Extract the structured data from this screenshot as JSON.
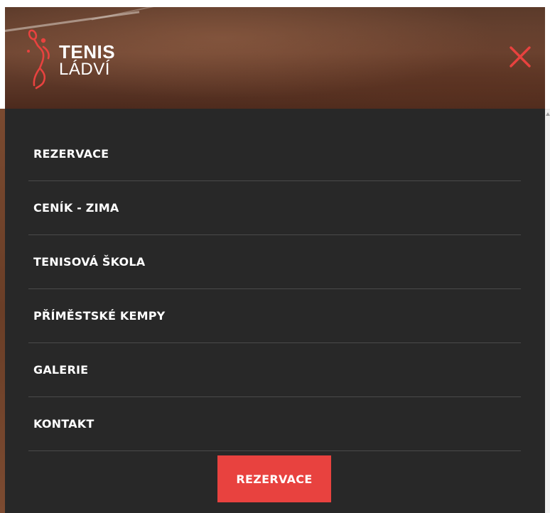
{
  "header": {
    "logo_line1": "TENIS",
    "logo_line2": "LÁDVÍ",
    "accent_color": "#e8423f",
    "close_icon": "close-icon"
  },
  "menu": {
    "items": [
      {
        "label": "REZERVACE"
      },
      {
        "label": "CENÍK - ZIMA"
      },
      {
        "label": "TENISOVÁ ŠKOLA"
      },
      {
        "label": "PŘÍMĚSTSKÉ KEMPY"
      },
      {
        "label": "GALERIE"
      },
      {
        "label": "KONTAKT"
      }
    ],
    "cta_label": "REZERVACE",
    "background_color": "#282828",
    "divider_color": "#4a4a4a"
  }
}
